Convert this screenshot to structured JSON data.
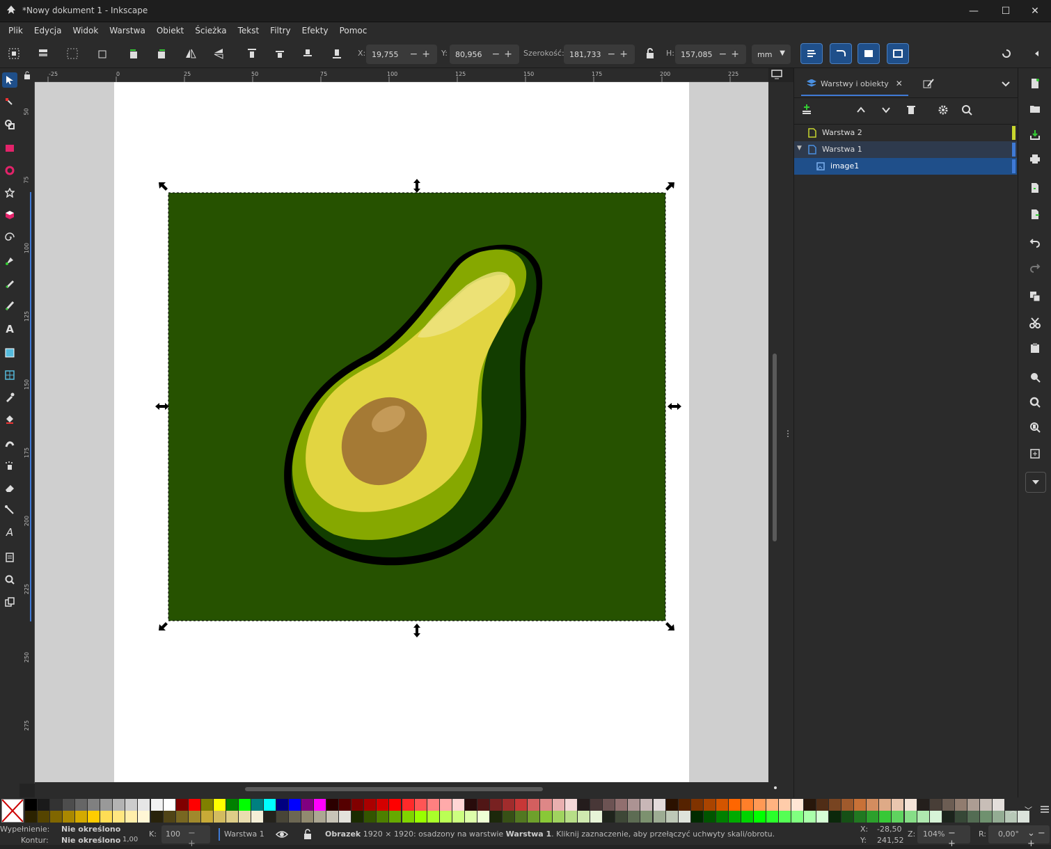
{
  "window": {
    "title": "*Nowy dokument 1 - Inkscape",
    "minimize": "—",
    "maximize": "☐",
    "close": "✕"
  },
  "menu": [
    "Plik",
    "Edycja",
    "Widok",
    "Warstwa",
    "Obiekt",
    "Ścieżka",
    "Tekst",
    "Filtry",
    "Efekty",
    "Pomoc"
  ],
  "toolbar": {
    "x_label": "X:",
    "x_value": "19,755",
    "y_label": "Y:",
    "y_value": "80,956",
    "w_label": "Szerokość:",
    "w_value": "181,733",
    "h_label": "H:",
    "h_value": "157,085",
    "unit": "mm"
  },
  "rulers": {
    "h_ticks": [
      "-25",
      "0",
      "25",
      "50",
      "75",
      "100",
      "125",
      "150",
      "175",
      "200",
      "225"
    ],
    "v_ticks": [
      "50",
      "75",
      "100",
      "125",
      "150",
      "175",
      "200",
      "225",
      "250",
      "275"
    ]
  },
  "panel": {
    "tab_label": "Warstwy i obiekty",
    "layers": [
      {
        "label": "Warstwa 2",
        "color": "#c8d62e"
      },
      {
        "label": "Warstwa 1",
        "color": "#3f7ad6"
      },
      {
        "label": "image1",
        "color": "#3f7ad6"
      }
    ]
  },
  "status": {
    "fill_label": "Wypełnienie:",
    "fill_value": "Nie określono",
    "stroke_label": "Kontur:",
    "stroke_value": "Nie określono",
    "stroke_width": "1,00",
    "opacity_label": "K:",
    "opacity_value": "100",
    "layer": "Warstwa 1",
    "message_bold": "Obrazek",
    "message_dims": " 1920 × 1920: osadzony na warstwie ",
    "message_layer": "Warstwa 1",
    "message_tail": ". Kliknij zaznaczenie, aby przełączyć uchwyty skali/obrotu.",
    "cx_label": "X:",
    "cx_value": "-28,50",
    "cy_label": "Y:",
    "cy_value": "241,52",
    "zoom_label": "Z:",
    "zoom_value": "104%",
    "rot_label": "R:",
    "rot_value": "0,00°"
  },
  "colors": {
    "accent": "#3f7ad6",
    "selection": "#1f4f8a",
    "avocado_bg": "#265200"
  }
}
